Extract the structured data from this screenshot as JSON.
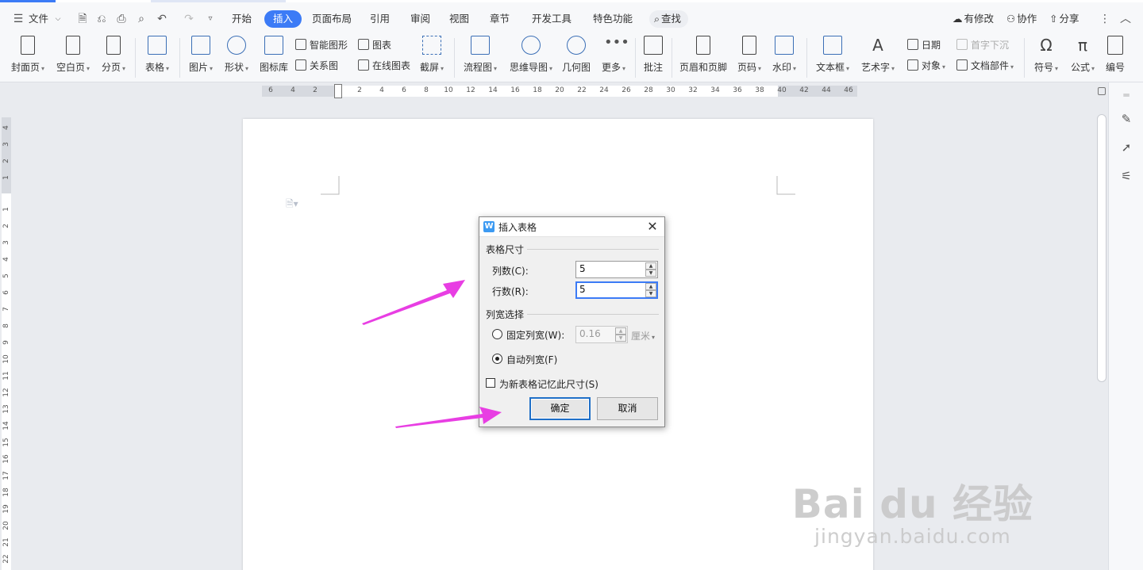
{
  "menubar": {
    "file_label": "文件",
    "tabs": [
      "开始",
      "插入",
      "页面布局",
      "引用",
      "审阅",
      "视图",
      "章节",
      "开发工具",
      "特色功能"
    ],
    "active_tab": "插入",
    "search_label": "查找",
    "right_items": [
      "有修改",
      "协作",
      "分享"
    ]
  },
  "ribbon": {
    "cover": "封面页",
    "blank": "空白页",
    "pagebreak": "分页",
    "table": "表格",
    "picture": "图片",
    "shape": "形状",
    "iconlib": "图标库",
    "smartart": "智能图形",
    "chart": "图表",
    "relation": "关系图",
    "onlinechart": "在线图表",
    "screenshot": "截屏",
    "flowchart": "流程图",
    "mindmap": "思维导图",
    "geometry": "几何图",
    "more": "更多",
    "comment": "批注",
    "headerfooter": "页眉和页脚",
    "pagenum": "页码",
    "watermark": "水印",
    "textbox": "文本框",
    "wordart": "艺术字",
    "date": "日期",
    "object": "对象",
    "dropcap": "首字下沉",
    "docparts": "文档部件",
    "symbol": "符号",
    "formula": "公式",
    "numbering": "编号"
  },
  "ruler": {
    "h_ticks": [
      "6",
      "4",
      "2",
      "2",
      "4",
      "6",
      "8",
      "10",
      "12",
      "14",
      "16",
      "18",
      "20",
      "22",
      "24",
      "26",
      "28",
      "30",
      "32",
      "34",
      "36",
      "38",
      "40",
      "42",
      "44",
      "46"
    ],
    "v_ticks_top": [
      "4",
      "3",
      "2",
      "1"
    ],
    "v_ticks": [
      "1",
      "2",
      "3",
      "4",
      "5",
      "6",
      "7",
      "8",
      "9",
      "10",
      "11",
      "12",
      "13",
      "14",
      "15",
      "16",
      "17",
      "18",
      "19",
      "20",
      "21",
      "22"
    ]
  },
  "dialog": {
    "title": "插入表格",
    "group_size": "表格尺寸",
    "cols_label": "列数(C):",
    "cols_value": "5",
    "rows_label": "行数(R):",
    "rows_value": "5",
    "group_width": "列宽选择",
    "fixed_label": "固定列宽(W):",
    "fixed_value": "0.16",
    "fixed_unit": "厘米",
    "auto_label": "自动列宽(F)",
    "remember_label": "为新表格记忆此尺寸(S)",
    "ok_label": "确定",
    "cancel_label": "取消",
    "selected_mode": "auto",
    "remember_checked": false
  },
  "watermark": {
    "main": "Bai du 经验",
    "sub": "jingyan.baidu.com"
  },
  "colors": {
    "accent": "#3c7bf6",
    "arrow": "#e83ee3"
  }
}
